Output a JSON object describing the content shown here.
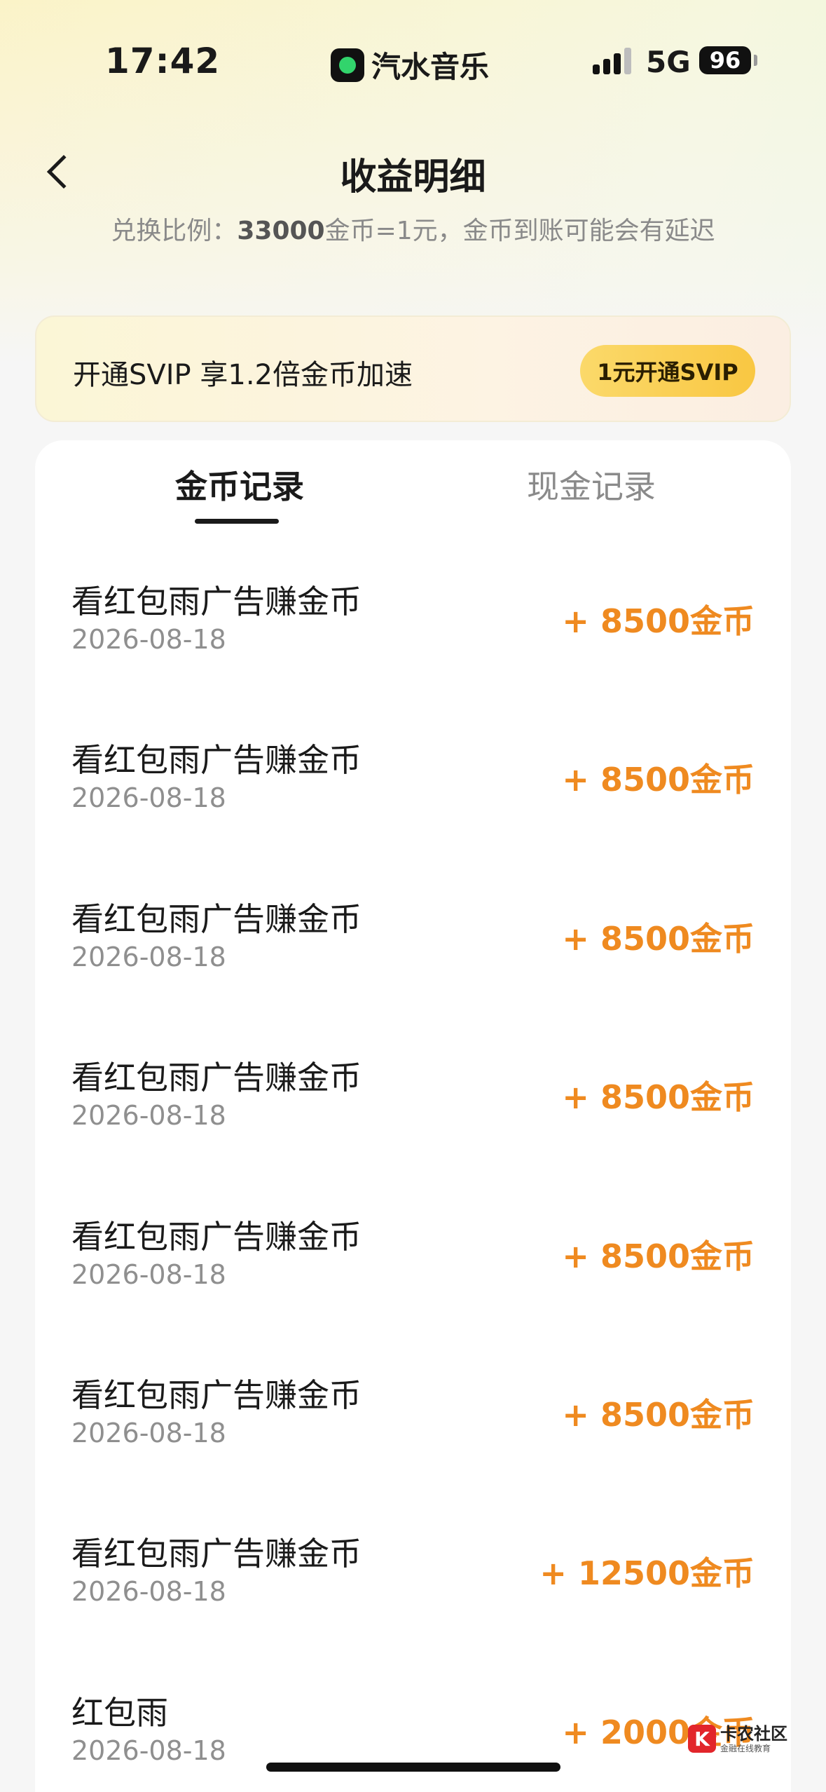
{
  "status_bar": {
    "time": "17:42",
    "app_name": "汽水音乐",
    "network": "5G",
    "battery": "96"
  },
  "header": {
    "title": "收益明细",
    "subtitle_prefix": "兑换比例：",
    "subtitle_bold": "33000",
    "subtitle_suffix": "金币=1元，金币到账可能会有延迟"
  },
  "svip": {
    "text": "开通SVIP 享1.2倍金币加速",
    "button_label": "1元开通SVIP"
  },
  "tabs": [
    {
      "label": "金币记录",
      "active": true
    },
    {
      "label": "现金记录",
      "active": false
    }
  ],
  "records": [
    {
      "title": "看红包雨广告赚金币",
      "date": "2026-08-18",
      "amount": "+ 8500金币"
    },
    {
      "title": "看红包雨广告赚金币",
      "date": "2026-08-18",
      "amount": "+ 8500金币"
    },
    {
      "title": "看红包雨广告赚金币",
      "date": "2026-08-18",
      "amount": "+ 8500金币"
    },
    {
      "title": "看红包雨广告赚金币",
      "date": "2026-08-18",
      "amount": "+ 8500金币"
    },
    {
      "title": "看红包雨广告赚金币",
      "date": "2026-08-18",
      "amount": "+ 8500金币"
    },
    {
      "title": "看红包雨广告赚金币",
      "date": "2026-08-18",
      "amount": "+ 8500金币"
    },
    {
      "title": "看红包雨广告赚金币",
      "date": "2026-08-18",
      "amount": "+ 12500金币"
    },
    {
      "title": "红包雨",
      "date": "2026-08-18",
      "amount": "+ 2000金币"
    }
  ],
  "watermark": {
    "main": "卡农社区",
    "sub": "金融在线教育"
  },
  "colors": {
    "amount": "#ef8a20",
    "svip_button": "#f9c742"
  }
}
